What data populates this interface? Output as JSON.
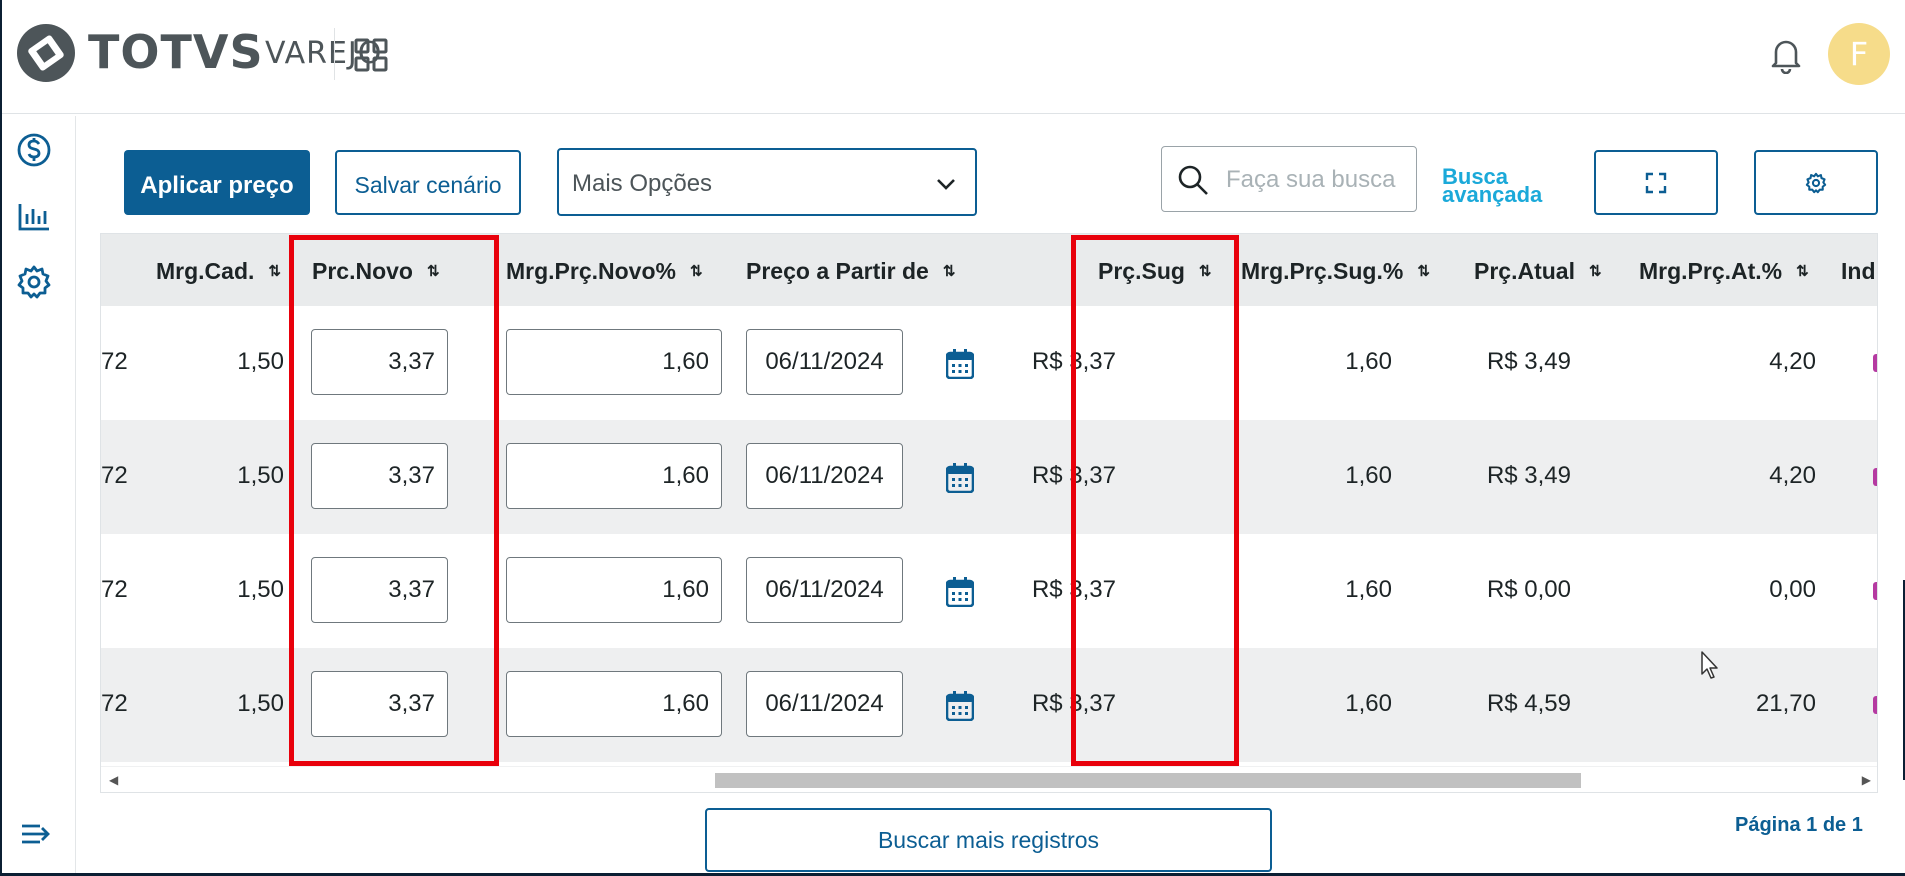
{
  "header": {
    "brand": "TOTVS",
    "brand_sub": "VAREJO",
    "avatar_letter": "F"
  },
  "sidebar": {
    "items": [
      {
        "icon": "dollar-icon"
      },
      {
        "icon": "chart-icon"
      },
      {
        "icon": "gear-icon"
      }
    ],
    "bottom_icon": "collapse-menu-icon"
  },
  "toolbar": {
    "apply_label": "Aplicar preço",
    "save_label": "Salvar cenário",
    "more_options": "Mais Opções",
    "search_placeholder": "Faça sua busca",
    "advanced_search": "Busca avançada"
  },
  "grid": {
    "columns": {
      "partial": "",
      "mrg_cad": "Mrg.Cad.",
      "prc_novo": "Prc.Novo",
      "mrg_prc_novo": "Mrg.Prç.Novo%",
      "preco_a_partir": "Preço a Partir de",
      "prc_sug": "Prç.Sug",
      "mrg_prc_sug": "Mrg.Prç.Sug.%",
      "prc_atual": "Prç.Atual",
      "mrg_prc_at": "Mrg.Prç.At.%",
      "ind": "Ind."
    },
    "sort_glyph": "⇅",
    "rows": [
      {
        "partial": "72",
        "mrg_cad": "1,50",
        "prc_novo": "3,37",
        "mrg_prc_novo": "1,60",
        "date": "06/11/2024",
        "prc_sug": "R$ 3,37",
        "mrg_prc_sug": "1,60",
        "prc_atual": "R$ 3,49",
        "mrg_prc_at": "4,20"
      },
      {
        "partial": "72",
        "mrg_cad": "1,50",
        "prc_novo": "3,37",
        "mrg_prc_novo": "1,60",
        "date": "06/11/2024",
        "prc_sug": "R$ 3,37",
        "mrg_prc_sug": "1,60",
        "prc_atual": "R$ 3,49",
        "mrg_prc_at": "4,20"
      },
      {
        "partial": "72",
        "mrg_cad": "1,50",
        "prc_novo": "3,37",
        "mrg_prc_novo": "1,60",
        "date": "06/11/2024",
        "prc_sug": "R$ 3,37",
        "mrg_prc_sug": "1,60",
        "prc_atual": "R$ 0,00",
        "mrg_prc_at": "0,00"
      },
      {
        "partial": "72",
        "mrg_cad": "1,50",
        "prc_novo": "3,37",
        "mrg_prc_novo": "1,60",
        "date": "06/11/2024",
        "prc_sug": "R$ 3,37",
        "mrg_prc_sug": "1,60",
        "prc_atual": "R$ 4,59",
        "mrg_prc_at": "21,70"
      }
    ]
  },
  "footer": {
    "more_records": "Buscar mais registros",
    "pagination": "Página 1 de 1"
  },
  "colors": {
    "primary": "#0c5e93",
    "accent": "#1ba9d9",
    "highlight": "#e8000b",
    "avatar_bg": "#f6dc8a"
  }
}
